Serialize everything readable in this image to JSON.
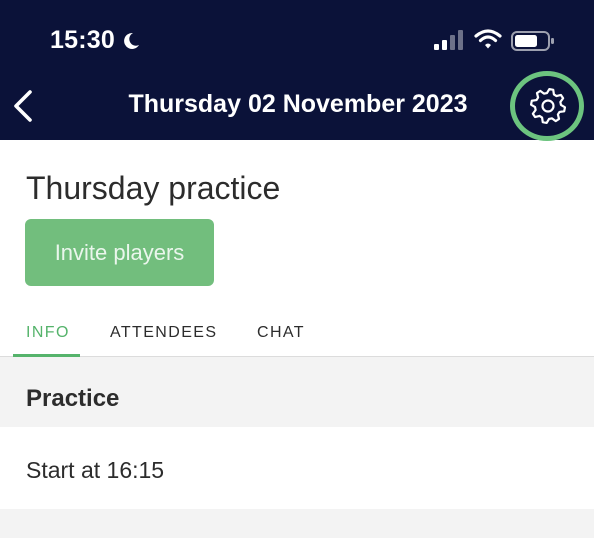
{
  "status_bar": {
    "time": "15:30",
    "icons": [
      "moon-icon",
      "signal-icon",
      "wifi-icon",
      "battery-icon"
    ]
  },
  "header": {
    "title": "Thursday 02 November 2023",
    "back_icon": "chevron-left-icon",
    "settings_icon": "gear-icon",
    "background_color": "#0b1239",
    "highlight_color": "#6cc47f"
  },
  "page": {
    "title": "Thursday practice",
    "invite_button": "Invite players",
    "accent_color": "#55b36b"
  },
  "tabs": [
    {
      "label": "INFO",
      "active": true
    },
    {
      "label": "ATTENDEES",
      "active": false
    },
    {
      "label": "CHAT",
      "active": false
    }
  ],
  "info": {
    "section_title": "Practice",
    "start_text": "Start at 16:15"
  }
}
